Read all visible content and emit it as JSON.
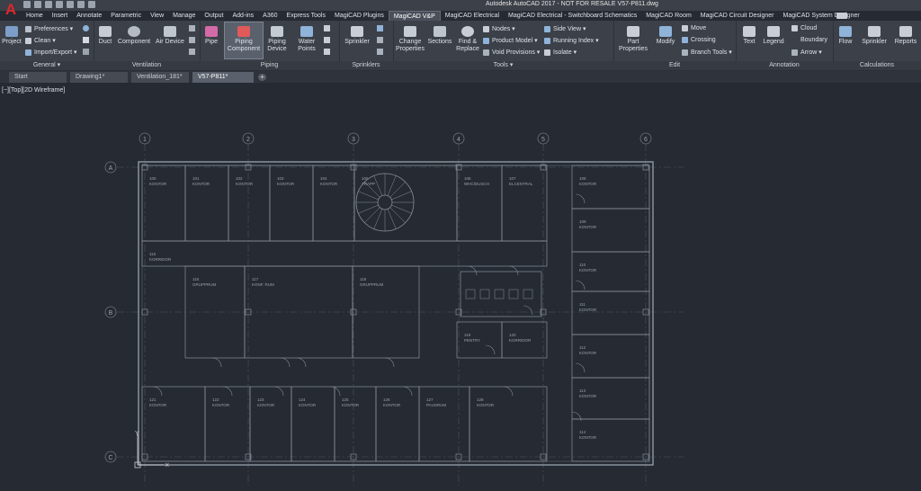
{
  "app": {
    "logo": "A",
    "title": "Autodesk AutoCAD 2017 - NOT FOR RESALE    V57-P811.dwg"
  },
  "ribbon_tabs": [
    "Home",
    "Insert",
    "Annotate",
    "Parametric",
    "View",
    "Manage",
    "Output",
    "Add-ins",
    "A360",
    "Express Tools",
    "MagiCAD Plugins",
    "MagiCAD V&P",
    "MagiCAD Electrical",
    "MagiCAD Electrical - Switchboard Schematics",
    "MagiCAD Room",
    "MagiCAD Circuit Designer",
    "MagiCAD System Designer"
  ],
  "active_tab_index": 11,
  "panels": {
    "general": {
      "label": "General ▾",
      "project": "Project",
      "preferences": "Preferences ▾",
      "clean": "Clean ▾",
      "import_export": "Import/Export ▾"
    },
    "ventilation": {
      "label": "Ventilation",
      "duct": "Duct",
      "component": "Component",
      "air_device": "Air Device"
    },
    "piping": {
      "label": "Piping",
      "pipe": "Pipe",
      "piping_component": "Piping Component",
      "piping_device": "Piping Device",
      "water_points": "Water Points"
    },
    "sprinklers": {
      "label": "Sprinklers",
      "sprinkler": "Sprinkler"
    },
    "tools": {
      "label": "Tools ▾",
      "change_properties": "Change Properties",
      "sections": "Sections",
      "find_replace": "Find & Replace",
      "nodes": "Nodes ▾",
      "product_model": "Product Model ▾",
      "void_provisions": "Void Provisions ▾",
      "side_view": "Side View ▾",
      "running_index": "Running Index ▾",
      "isolate": "Isolate ▾"
    },
    "edit": {
      "label": "Edit",
      "part_properties": "Part Properties",
      "modify": "Modify",
      "move": "Move",
      "crossing": "Crossing",
      "branch_tools": "Branch Tools ▾"
    },
    "annotation": {
      "label": "Annotation",
      "text": "Text",
      "legend": "Legend",
      "cloud": "Cloud",
      "boundary": "Boundary",
      "arrow": "Arrow ▾"
    },
    "calculations": {
      "label": "Calculations",
      "flow": "Flow",
      "sprinkler": "Sprinkler",
      "reports": "Reports"
    }
  },
  "file_tabs": [
    {
      "label": "Start"
    },
    {
      "label": "Drawing1*"
    },
    {
      "label": "Ventilation_181*"
    },
    {
      "label": "V57-P811*"
    }
  ],
  "active_file_tab": 3,
  "viewport_label": "[−][Top][2D Wireframe]",
  "drawing": {
    "grid_columns": [
      "1",
      "2",
      "3",
      "4",
      "5",
      "6"
    ],
    "grid_rows": [
      "A",
      "B",
      "C"
    ],
    "rooms": [
      {
        "num": "100",
        "name": "KONTOR"
      },
      {
        "num": "101",
        "name": "KONTOR"
      },
      {
        "num": "102",
        "name": "KONTOR"
      },
      {
        "num": "103",
        "name": "KONTOR"
      },
      {
        "num": "104",
        "name": "KONTOR"
      },
      {
        "num": "105",
        "name": "TRAPP"
      },
      {
        "num": "106",
        "name": "WHC/DUSCH"
      },
      {
        "num": "107",
        "name": "ELCENTRAL"
      },
      {
        "num": "108",
        "name": "KONTOR"
      },
      {
        "num": "109",
        "name": "KONTOR"
      },
      {
        "num": "110",
        "name": "KONTOR"
      },
      {
        "num": "111",
        "name": "KONTOR"
      },
      {
        "num": "112",
        "name": "KONTOR"
      },
      {
        "num": "113",
        "name": "KONTOR"
      },
      {
        "num": "114",
        "name": "KONTOR"
      },
      {
        "num": "115",
        "name": "KORRIDOR"
      },
      {
        "num": "116",
        "name": "GRUPPRUM"
      },
      {
        "num": "117",
        "name": "KONF. RUM"
      },
      {
        "num": "118",
        "name": "GRUPPRUM"
      },
      {
        "num": "119",
        "name": "PENTRY"
      },
      {
        "num": "120",
        "name": "KORRIDOR"
      },
      {
        "num": "121",
        "name": "KONTOR"
      },
      {
        "num": "122",
        "name": "KONTOR"
      },
      {
        "num": "123",
        "name": "KONTOR"
      },
      {
        "num": "124",
        "name": "KONTOR"
      },
      {
        "num": "125",
        "name": "KONTOR"
      },
      {
        "num": "126",
        "name": "KONTOR"
      },
      {
        "num": "127",
        "name": "PAUSRUM"
      },
      {
        "num": "128",
        "name": "KONTOR"
      }
    ]
  },
  "colors": {
    "background": "#252a33",
    "ribbon": "#3c4048",
    "line": "#8a919c",
    "logo": "#e0262b"
  }
}
